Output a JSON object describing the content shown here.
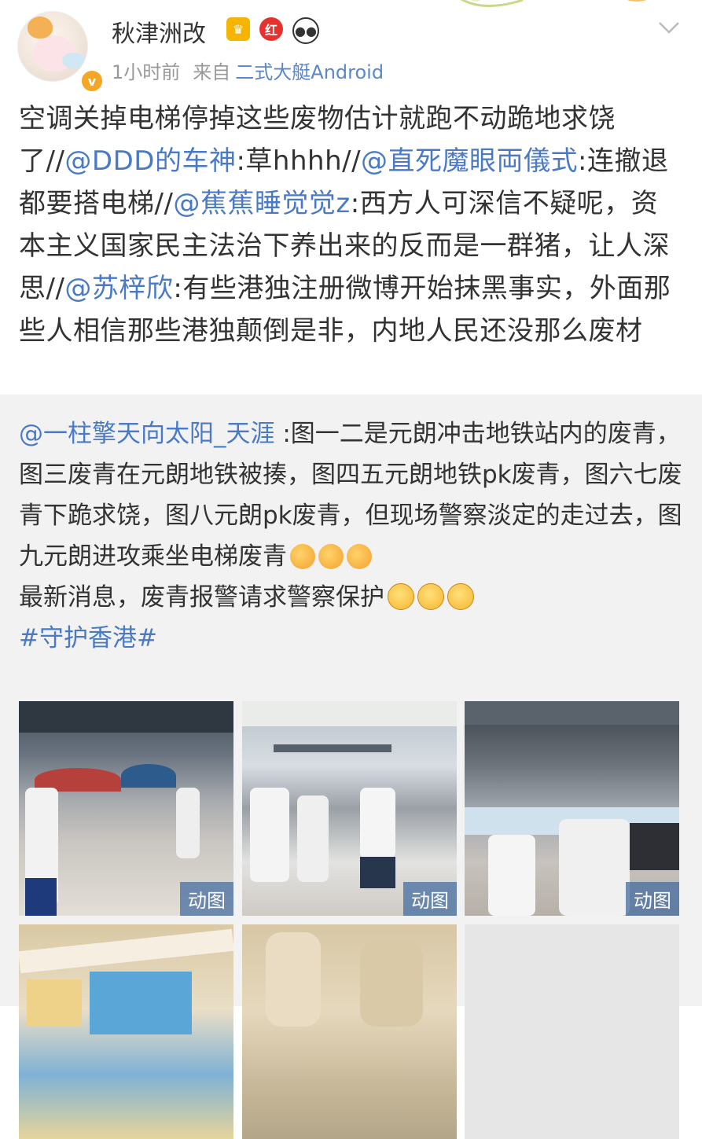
{
  "post": {
    "username": "秋津洲改",
    "badges": [
      "crown-badge",
      "red-badge",
      "panda-badge"
    ],
    "badge_labels": {
      "red": "红"
    },
    "verified_label": "v",
    "time": "1小时前",
    "from_label": "来自",
    "source": "二式大艇Android",
    "text": {
      "t1": "空调关掉电梯停掉这些废物估计就跑不动跪地求饶了//",
      "m1": "@DDD的车神",
      "t2": ":草hhhh//",
      "m2": "@直死魔眼両儀式",
      "t3": ":连撤退都要搭电梯//",
      "m3": "@蕉蕉睡觉觉z",
      "t4": ":西方人可深信不疑呢，资本主义国家民主法治下养出来的反而是一群猪，让人深思//",
      "m4": "@苏梓欣",
      "t5": ":有些港独注册微博开始抹黑事实，外面那些人相信那些港独颠倒是非，内地人民还没那么废材"
    }
  },
  "repost": {
    "mention": "@一柱擎天向太阳_天涯",
    "text1": " :图一二是元朗冲击地铁站内的废青，图三废青在元朗地铁被揍，图四五元朗地铁pk废青，图六七废青下跪求饶，图八元朗pk废青，但现场警察淡定的走过去，图九元朗进攻乘坐电梯废青",
    "text2": "最新消息，废青报警请求警察保护",
    "topic": "#守护香港#",
    "emojis_line1": [
      "fist-emoji",
      "fist-emoji",
      "fist-emoji"
    ],
    "emojis_line2": [
      "laugh-cry-emoji",
      "laugh-cry-emoji",
      "laugh-cry-emoji"
    ],
    "gif_label": "动图"
  }
}
